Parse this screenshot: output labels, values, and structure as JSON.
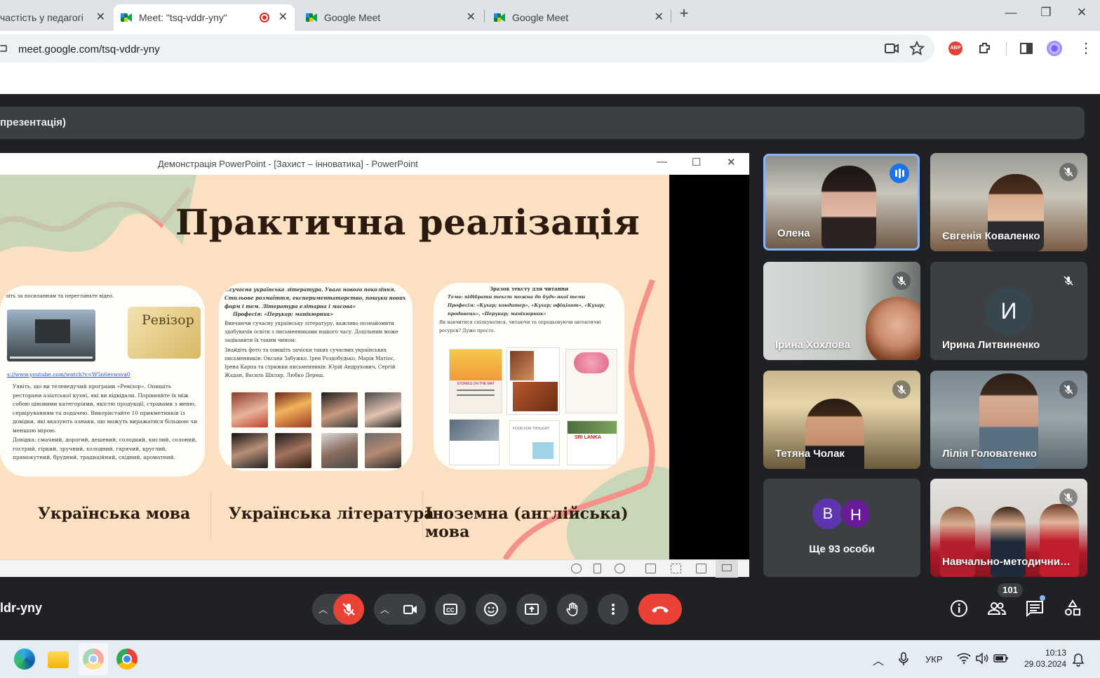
{
  "browser": {
    "tabs": [
      {
        "title": "частість у педагогічно",
        "active": false
      },
      {
        "title": "Meet: \"tsq-vddr-yny\"",
        "active": true
      },
      {
        "title": "Google Meet",
        "active": false
      },
      {
        "title": "Google Meet",
        "active": false
      }
    ],
    "new_tab": "+",
    "url": "meet.google.com/tsq-vddr-yny",
    "window_controls": {
      "minimize": "—",
      "maximize": "❐",
      "close": "✕"
    },
    "abp_label": "ABP"
  },
  "meet": {
    "presentation_title": "презентація)",
    "meeting_code": "ldr-yny",
    "participant_count": "101",
    "participants": [
      {
        "name": "Олена",
        "speaking": true
      },
      {
        "name": "Євгенія Коваленко",
        "muted": true
      },
      {
        "name": "Ірина Хохлова",
        "muted": true
      },
      {
        "name": "Ирина Литвиненко",
        "initial": "И",
        "muted": true
      },
      {
        "name": "Тетяна Чолак",
        "muted": true
      },
      {
        "name": "Лілія Головатенко",
        "muted": true
      },
      {
        "name": "Ще 93 особи",
        "initials": [
          "В",
          "Н"
        ]
      },
      {
        "name": "Навчально-методични…",
        "muted": true
      }
    ],
    "colors": {
      "accent_blue": "#8ab4f8",
      "end_call": "#ea4335",
      "mic_off": "#ea4335"
    }
  },
  "powerpoint": {
    "window_title": "Демонстрація PowerPoint - [Захист – інноватика] - PowerPoint",
    "slide": {
      "heading": "Практична реалізація",
      "subjects": [
        "Українська мова",
        "Українська література",
        "Іноземна (англійська) мова"
      ],
      "card1": {
        "link": "s://www.youtube.com/watch?v=W5n6evwsva0",
        "badge": "Ревізор",
        "intro": "літь за посиланням та перегляньте відео.",
        "text": "Уявіть, що ви телеведучий програми «Ревізор». Опишіть ресторани азіатської кухні, які ви відвідали. Порівняйте їх між собою ціновими категоріями, якістю продукції, стравами з меню, сервіруванням та подачею. Використайте 10 прикметників із довідки, які вказують ознаки, що можуть виражатися більшою чи меншою мірою.",
        "help": "Довідка: смачний, дорогий, дешевий, солодкий, кислий, солоний, гострий, гіркий, зручний, холодний, гарячий, круглий, прямокутний, брудний, традиційний, східний, ароматний."
      },
      "card2": {
        "top": "…сучасна українська література. Увага нового покоління. Стильове розмаїття, експериментаторство, пошуки нових форм і тем. Література елітарна і масова»",
        "profession": "Професія: «Перукар; манікюрник»",
        "text1": "Вивчаючи сучасну українську літературу, важливо познайомити здобувачів освіти з письменниками нашого часу. Доцільним може зацікавити їх таким чином:",
        "text2": "Знайдіть фото та опишіть зачіски таких сучасних українських письменників: Оксана Забужко, Ірен Роздобудько, Марія Матіос, Ірена Карпа та стрижки письменників: Юрій Андрухович, Сергій Жадан, Василь Шкляр, Любко Дереш."
      },
      "card3": {
        "top": "Зразок тексту для читання",
        "theme": "Тема: підібрати текст можна до будь-якої теми",
        "profession": "Професія: «Кухар; кондитер», «Кухар; офіціант», «Кухар; продавець», «Перукар; манікюрник»",
        "text": "Як навчитися спілкуватися, читаючи та опрацьовуючи автентичні ресурси? Дуже просто.",
        "magazine1": "STORIES ON THE MAT",
        "magazine2": "FOOD FOR THOUGHT",
        "magazine3": "SRI LANKA"
      }
    }
  },
  "taskbar": {
    "language": "УКР",
    "time": "10:13",
    "date": "29.03.2024"
  }
}
